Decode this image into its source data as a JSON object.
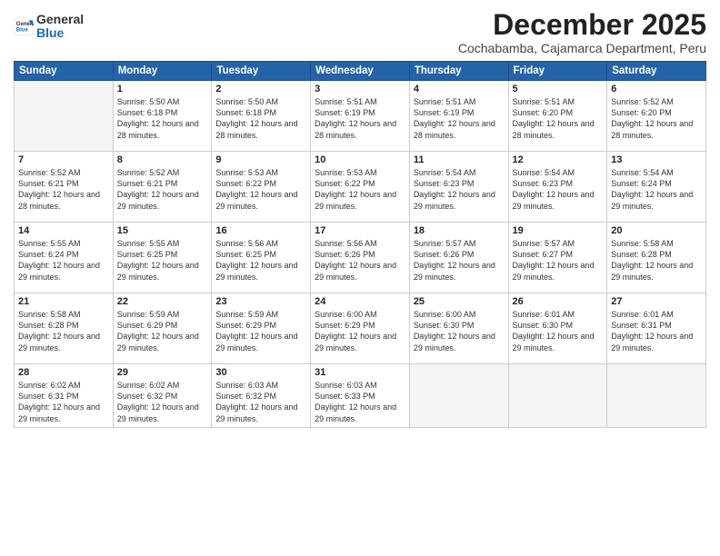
{
  "logo": {
    "general": "General",
    "blue": "Blue"
  },
  "header": {
    "title": "December 2025",
    "subtitle": "Cochabamba, Cajamarca Department, Peru"
  },
  "weekdays": [
    "Sunday",
    "Monday",
    "Tuesday",
    "Wednesday",
    "Thursday",
    "Friday",
    "Saturday"
  ],
  "weeks": [
    [
      {
        "day": "",
        "empty": true
      },
      {
        "day": "1",
        "sunrise": "Sunrise: 5:50 AM",
        "sunset": "Sunset: 6:18 PM",
        "daylight": "Daylight: 12 hours and 28 minutes."
      },
      {
        "day": "2",
        "sunrise": "Sunrise: 5:50 AM",
        "sunset": "Sunset: 6:18 PM",
        "daylight": "Daylight: 12 hours and 28 minutes."
      },
      {
        "day": "3",
        "sunrise": "Sunrise: 5:51 AM",
        "sunset": "Sunset: 6:19 PM",
        "daylight": "Daylight: 12 hours and 28 minutes."
      },
      {
        "day": "4",
        "sunrise": "Sunrise: 5:51 AM",
        "sunset": "Sunset: 6:19 PM",
        "daylight": "Daylight: 12 hours and 28 minutes."
      },
      {
        "day": "5",
        "sunrise": "Sunrise: 5:51 AM",
        "sunset": "Sunset: 6:20 PM",
        "daylight": "Daylight: 12 hours and 28 minutes."
      },
      {
        "day": "6",
        "sunrise": "Sunrise: 5:52 AM",
        "sunset": "Sunset: 6:20 PM",
        "daylight": "Daylight: 12 hours and 28 minutes."
      }
    ],
    [
      {
        "day": "7",
        "sunrise": "Sunrise: 5:52 AM",
        "sunset": "Sunset: 6:21 PM",
        "daylight": "Daylight: 12 hours and 28 minutes."
      },
      {
        "day": "8",
        "sunrise": "Sunrise: 5:52 AM",
        "sunset": "Sunset: 6:21 PM",
        "daylight": "Daylight: 12 hours and 29 minutes."
      },
      {
        "day": "9",
        "sunrise": "Sunrise: 5:53 AM",
        "sunset": "Sunset: 6:22 PM",
        "daylight": "Daylight: 12 hours and 29 minutes."
      },
      {
        "day": "10",
        "sunrise": "Sunrise: 5:53 AM",
        "sunset": "Sunset: 6:22 PM",
        "daylight": "Daylight: 12 hours and 29 minutes."
      },
      {
        "day": "11",
        "sunrise": "Sunrise: 5:54 AM",
        "sunset": "Sunset: 6:23 PM",
        "daylight": "Daylight: 12 hours and 29 minutes."
      },
      {
        "day": "12",
        "sunrise": "Sunrise: 5:54 AM",
        "sunset": "Sunset: 6:23 PM",
        "daylight": "Daylight: 12 hours and 29 minutes."
      },
      {
        "day": "13",
        "sunrise": "Sunrise: 5:54 AM",
        "sunset": "Sunset: 6:24 PM",
        "daylight": "Daylight: 12 hours and 29 minutes."
      }
    ],
    [
      {
        "day": "14",
        "sunrise": "Sunrise: 5:55 AM",
        "sunset": "Sunset: 6:24 PM",
        "daylight": "Daylight: 12 hours and 29 minutes."
      },
      {
        "day": "15",
        "sunrise": "Sunrise: 5:55 AM",
        "sunset": "Sunset: 6:25 PM",
        "daylight": "Daylight: 12 hours and 29 minutes."
      },
      {
        "day": "16",
        "sunrise": "Sunrise: 5:56 AM",
        "sunset": "Sunset: 6:25 PM",
        "daylight": "Daylight: 12 hours and 29 minutes."
      },
      {
        "day": "17",
        "sunrise": "Sunrise: 5:56 AM",
        "sunset": "Sunset: 6:26 PM",
        "daylight": "Daylight: 12 hours and 29 minutes."
      },
      {
        "day": "18",
        "sunrise": "Sunrise: 5:57 AM",
        "sunset": "Sunset: 6:26 PM",
        "daylight": "Daylight: 12 hours and 29 minutes."
      },
      {
        "day": "19",
        "sunrise": "Sunrise: 5:57 AM",
        "sunset": "Sunset: 6:27 PM",
        "daylight": "Daylight: 12 hours and 29 minutes."
      },
      {
        "day": "20",
        "sunrise": "Sunrise: 5:58 AM",
        "sunset": "Sunset: 6:28 PM",
        "daylight": "Daylight: 12 hours and 29 minutes."
      }
    ],
    [
      {
        "day": "21",
        "sunrise": "Sunrise: 5:58 AM",
        "sunset": "Sunset: 6:28 PM",
        "daylight": "Daylight: 12 hours and 29 minutes."
      },
      {
        "day": "22",
        "sunrise": "Sunrise: 5:59 AM",
        "sunset": "Sunset: 6:29 PM",
        "daylight": "Daylight: 12 hours and 29 minutes."
      },
      {
        "day": "23",
        "sunrise": "Sunrise: 5:59 AM",
        "sunset": "Sunset: 6:29 PM",
        "daylight": "Daylight: 12 hours and 29 minutes."
      },
      {
        "day": "24",
        "sunrise": "Sunrise: 6:00 AM",
        "sunset": "Sunset: 6:29 PM",
        "daylight": "Daylight: 12 hours and 29 minutes."
      },
      {
        "day": "25",
        "sunrise": "Sunrise: 6:00 AM",
        "sunset": "Sunset: 6:30 PM",
        "daylight": "Daylight: 12 hours and 29 minutes."
      },
      {
        "day": "26",
        "sunrise": "Sunrise: 6:01 AM",
        "sunset": "Sunset: 6:30 PM",
        "daylight": "Daylight: 12 hours and 29 minutes."
      },
      {
        "day": "27",
        "sunrise": "Sunrise: 6:01 AM",
        "sunset": "Sunset: 6:31 PM",
        "daylight": "Daylight: 12 hours and 29 minutes."
      }
    ],
    [
      {
        "day": "28",
        "sunrise": "Sunrise: 6:02 AM",
        "sunset": "Sunset: 6:31 PM",
        "daylight": "Daylight: 12 hours and 29 minutes."
      },
      {
        "day": "29",
        "sunrise": "Sunrise: 6:02 AM",
        "sunset": "Sunset: 6:32 PM",
        "daylight": "Daylight: 12 hours and 29 minutes."
      },
      {
        "day": "30",
        "sunrise": "Sunrise: 6:03 AM",
        "sunset": "Sunset: 6:32 PM",
        "daylight": "Daylight: 12 hours and 29 minutes."
      },
      {
        "day": "31",
        "sunrise": "Sunrise: 6:03 AM",
        "sunset": "Sunset: 6:33 PM",
        "daylight": "Daylight: 12 hours and 29 minutes."
      },
      {
        "day": "",
        "empty": true
      },
      {
        "day": "",
        "empty": true
      },
      {
        "day": "",
        "empty": true
      }
    ]
  ]
}
